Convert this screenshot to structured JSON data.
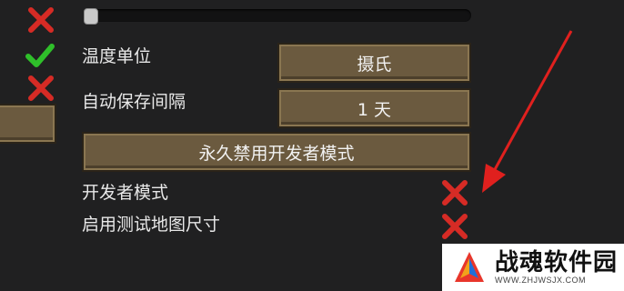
{
  "settings": {
    "temperature_unit_label": "温度单位",
    "temperature_unit_value": "摄氏",
    "autosave_interval_label": "自动保存间隔",
    "autosave_interval_value": "1 天",
    "disable_dev_mode_button": "永久禁用开发者模式",
    "dev_mode_label": "开发者模式",
    "test_map_sizes_label": "启用测试地图尺寸"
  },
  "slider": {
    "level": 0.0
  },
  "colors": {
    "check_green": "#2fbf2a",
    "cross_red": "#d62b25",
    "button_fill": "#6b5a3f",
    "arrow_red": "#e0201e"
  },
  "watermark": {
    "title": "战魂软件园",
    "url": "WWW.ZHJWSJX.COM"
  }
}
